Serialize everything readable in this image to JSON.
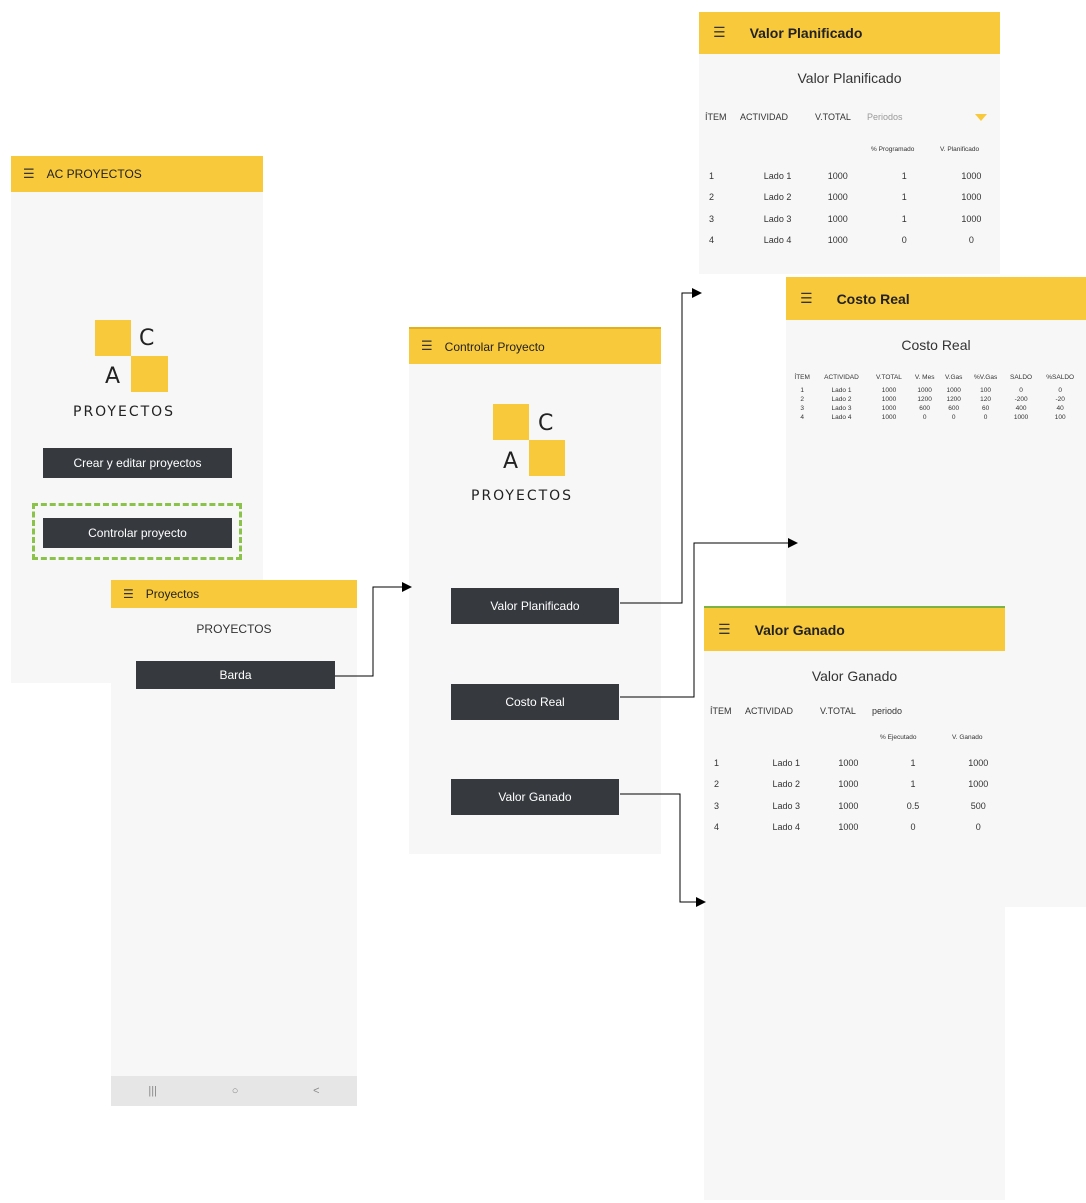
{
  "colors": {
    "accent": "#f9c93c",
    "button": "#363a3f",
    "screen_bg": "#f7f7f7",
    "highlight": "#8bc34a"
  },
  "home": {
    "title": "AC PROYECTOS",
    "menu_icon": "menu-icon",
    "logo": {
      "letter_top": "C",
      "letter_bottom": "A",
      "word": "PROYECTOS"
    },
    "buttons": {
      "create": "Crear y editar proyectos",
      "control": "Controlar proyecto"
    }
  },
  "proyectos": {
    "title": "Proyectos",
    "heading": "PROYECTOS",
    "project_button": "Barda",
    "nav": {
      "recent": "|||",
      "home": "○",
      "back": "<"
    }
  },
  "control": {
    "title": "Controlar Proyecto",
    "logo": {
      "letter_top": "C",
      "letter_bottom": "A",
      "word": "PROYECTOS"
    },
    "buttons": {
      "planned": "Valor Planificado",
      "actual": "Costo Real",
      "earned": "Valor Ganado"
    }
  },
  "planned": {
    "title": "Valor Planificado",
    "heading": "Valor Planificado",
    "columns": [
      "ÍTEM",
      "ACTIVIDAD",
      "V.TOTAL"
    ],
    "period_placeholder": "Periodos",
    "sub_columns": [
      "% Programado",
      "V. Planificado"
    ],
    "rows": [
      [
        "1",
        "Lado 1",
        "1000",
        "1",
        "1000"
      ],
      [
        "2",
        "Lado 2",
        "1000",
        "1",
        "1000"
      ],
      [
        "3",
        "Lado 3",
        "1000",
        "1",
        "1000"
      ],
      [
        "4",
        "Lado 4",
        "1000",
        "0",
        "0"
      ]
    ]
  },
  "actual": {
    "title": "Costo Real",
    "heading": "Costo Real",
    "columns": [
      "ÍTEM",
      "ACTIVIDAD",
      "V.TOTAL",
      "V. Mes",
      "V.Gas",
      "%V.Gas",
      "SALDO",
      "%SALDO"
    ],
    "rows": [
      [
        "1",
        "Lado 1",
        "1000",
        "1000",
        "1000",
        "100",
        "0",
        "0"
      ],
      [
        "2",
        "Lado 2",
        "1000",
        "1200",
        "1200",
        "120",
        "-200",
        "-20"
      ],
      [
        "3",
        "Lado 3",
        "1000",
        "600",
        "600",
        "60",
        "400",
        "40"
      ],
      [
        "4",
        "Lado 4",
        "1000",
        "0",
        "0",
        "0",
        "1000",
        "100"
      ]
    ]
  },
  "earned": {
    "title": "Valor Ganado",
    "heading": "Valor Ganado",
    "columns": [
      "ÍTEM",
      "ACTIVIDAD",
      "V.TOTAL",
      "periodo"
    ],
    "sub_columns": [
      "% Ejecutado",
      "V. Ganado"
    ],
    "rows": [
      [
        "1",
        "Lado 1",
        "1000",
        "1",
        "1000"
      ],
      [
        "2",
        "Lado 2",
        "1000",
        "1",
        "1000"
      ],
      [
        "3",
        "Lado 3",
        "1000",
        "0.5",
        "500"
      ],
      [
        "4",
        "Lado 4",
        "1000",
        "0",
        "0"
      ]
    ]
  }
}
